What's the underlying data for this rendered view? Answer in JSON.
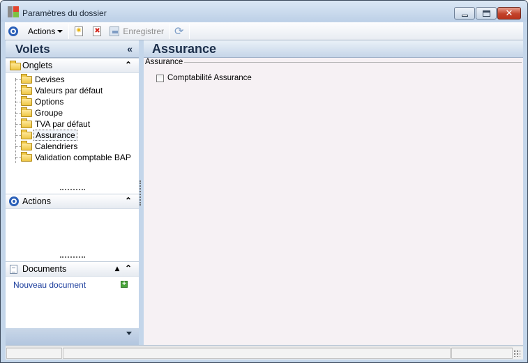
{
  "window": {
    "title": "Paramètres du dossier"
  },
  "toolbar": {
    "actions_label": "Actions",
    "save_label": "Enregistrer"
  },
  "sidebar": {
    "title": "Volets",
    "collapse_glyph": "«",
    "onglets": {
      "label": "Onglets",
      "items": [
        {
          "label": "Devises"
        },
        {
          "label": "Valeurs par défaut"
        },
        {
          "label": "Options"
        },
        {
          "label": "Groupe"
        },
        {
          "label": "TVA par défaut"
        },
        {
          "label": "Assurance",
          "selected": true
        },
        {
          "label": "Calendriers"
        },
        {
          "label": "Validation comptable BAP"
        }
      ]
    },
    "actions": {
      "label": "Actions"
    },
    "documents": {
      "label": "Documents",
      "new_document_label": "Nouveau document"
    }
  },
  "main": {
    "title": "Assurance",
    "group_label": "Assurance",
    "checkbox": {
      "label": "Comptabilité Assurance",
      "checked": false
    }
  },
  "colors": {
    "accent": "#2a5fb8",
    "header_text": "#1b2e4a",
    "link": "#1a3c9c"
  }
}
